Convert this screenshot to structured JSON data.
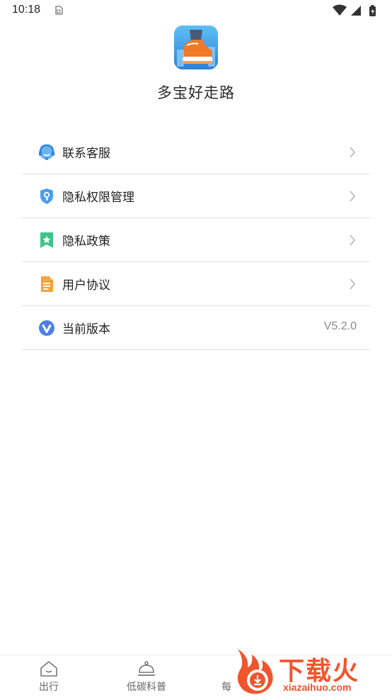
{
  "status_bar": {
    "time": "10:18"
  },
  "app": {
    "name": "多宝好走路"
  },
  "menu": {
    "items": [
      {
        "label": "联系客服",
        "icon": "customer-service-icon"
      },
      {
        "label": "隐私权限管理",
        "icon": "privacy-shield-icon"
      },
      {
        "label": "隐私政策",
        "icon": "bookmark-star-icon"
      },
      {
        "label": "用户协议",
        "icon": "document-icon"
      },
      {
        "label": "当前版本",
        "icon": "version-v-icon",
        "value": "V5.2.0"
      }
    ]
  },
  "bottom_nav": {
    "items": [
      {
        "label": "出行",
        "icon": "house-icon"
      },
      {
        "label": "低碳科普",
        "icon": "bell-dome-icon"
      },
      {
        "label": "每",
        "icon": "partial-tab-icon"
      }
    ]
  },
  "watermark": {
    "title": "下载火",
    "url": "xiazaihuo.com"
  },
  "colors": {
    "accent": "#f2542d",
    "divider": "#e0e0e0",
    "muted": "#8a8a8a"
  }
}
